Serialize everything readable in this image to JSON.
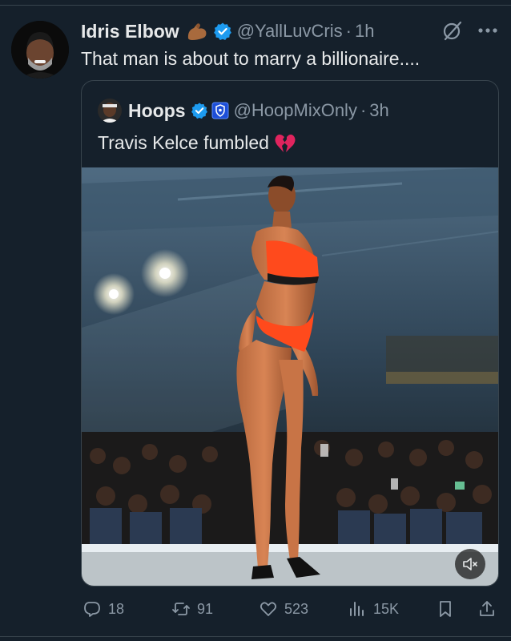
{
  "tweet": {
    "display_name": "Idris Elbow",
    "name_emoji": "flexed-biceps-emoji",
    "handle": "@YallLuvCris",
    "separator": "·",
    "time": "1h",
    "text": "That man is about to marry a billionaire...."
  },
  "quote": {
    "display_name": "Hoops",
    "handle": "@HoopMixOnly",
    "separator": "·",
    "time": "3h",
    "text": "Travis Kelce fumbled",
    "text_emoji": "broken-heart-emoji"
  },
  "actions": {
    "replies": "18",
    "reposts": "91",
    "likes": "523",
    "views": "15K"
  },
  "colors": {
    "background": "#15202b",
    "text": "#e7e9ea",
    "muted": "#8b98a5",
    "verified": "#1d9bf0",
    "border": "#38444d"
  },
  "icons": [
    "verified-badge-icon",
    "grok-icon",
    "more-icon",
    "affiliate-badge-icon",
    "mute-icon",
    "reply-icon",
    "repost-icon",
    "like-icon",
    "views-icon",
    "bookmark-icon",
    "share-icon"
  ]
}
